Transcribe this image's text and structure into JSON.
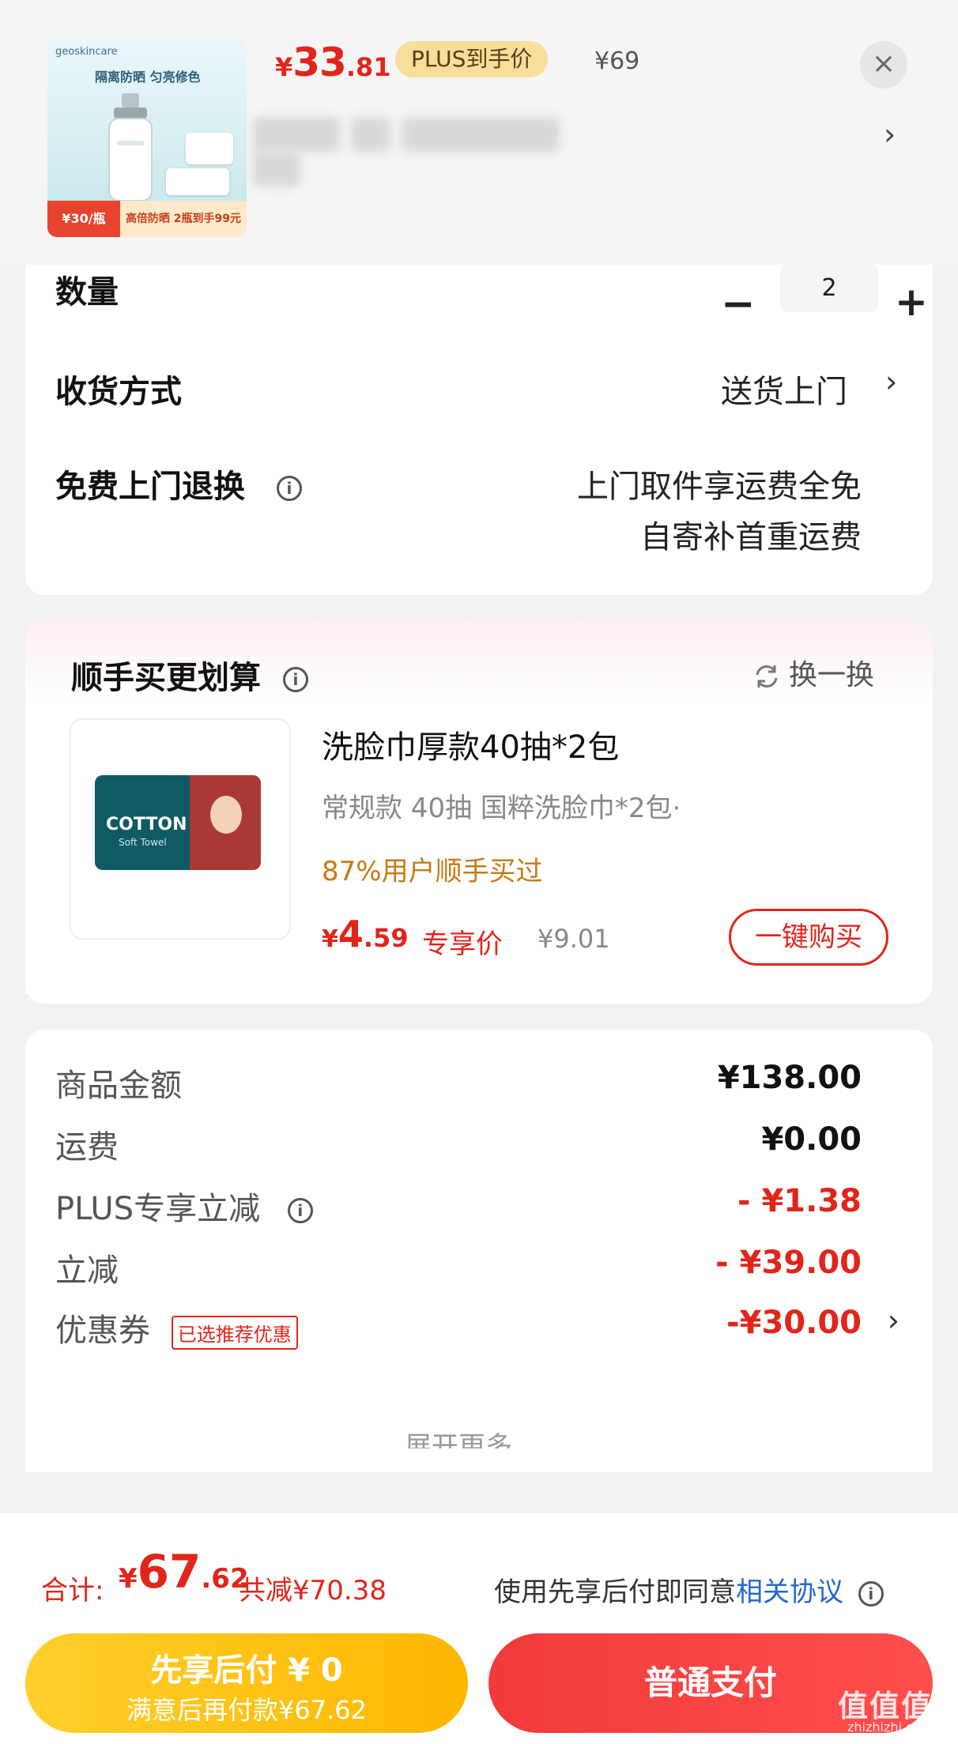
{
  "header": {
    "thumbnail": {
      "brand": "geoskincare",
      "slogan": "隔离防晒 匀亮修色",
      "badge_left": "¥30/瓶",
      "badge_right": "高倍防晒 2瓶到手99元"
    },
    "price_yen": "¥",
    "price_int": "33",
    "price_dec": ".81",
    "plus_label": "PLUS到手价",
    "original_price": "¥69",
    "close_symbol": "×",
    "chevron": "›"
  },
  "order": {
    "quantity_label": "数量",
    "minus": "−",
    "quantity": "2",
    "plus": "+",
    "delivery_label": "收货方式",
    "delivery_value": "送货上门",
    "delivery_chevron": "›",
    "return_label": "免费上门退换",
    "info": "i",
    "return_line1": "上门取件享运费全免",
    "return_line2": "自寄补首重运费"
  },
  "upsell": {
    "title": "顺手买更划算",
    "info": "i",
    "refresh_label": "换一换",
    "product": {
      "image_text": "COTTON",
      "image_subtext": "Soft Towel",
      "name": "洗脸巾厚款40抽*2包",
      "spec": "常规款 40抽 国粹洗脸巾*2包·",
      "buyers": "87%用户顺手买过",
      "price_yen": "¥",
      "price_int": "4",
      "price_dec": ".59",
      "exclusive_label": "专享价",
      "original_price": "¥9.01",
      "buy_button": "一键购买"
    }
  },
  "summary": {
    "rows": [
      {
        "label": "商品金额",
        "value": "¥138.00"
      },
      {
        "label": "运费",
        "value": "¥0.00"
      },
      {
        "label": "PLUS专享立减",
        "value": "- ¥1.38"
      },
      {
        "label": "立减",
        "value": "- ¥39.00"
      },
      {
        "label": "优惠券",
        "tag": "已选推荐优惠",
        "value": "-¥30.00"
      }
    ],
    "info": "i",
    "chevron": "›",
    "expand_hint": "展开更多"
  },
  "footer": {
    "total_label": "合计:",
    "total_yen": "¥",
    "total_int": "67",
    "total_dec": ".62",
    "saved": "共减¥70.38",
    "agree_text": "使用先享后付即同意",
    "agree_link": "相关协议",
    "info": "i",
    "bnpl_title": "先享后付 ¥ 0",
    "bnpl_subtitle": "满意后再付款¥67.62",
    "pay_button": "普通支付",
    "watermark": "值值值",
    "watermark_url": "zhizhizhi.com"
  },
  "colors": {
    "accent_red": "#e1251b",
    "gold": "#ffc107",
    "link_blue": "#2468c9",
    "orange_text": "#c77a14"
  }
}
